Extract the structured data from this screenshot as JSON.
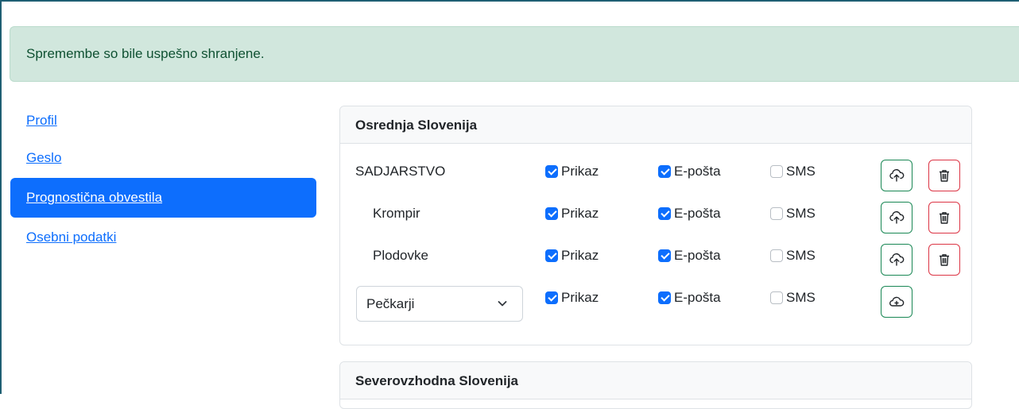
{
  "alert": {
    "message": "Spremembe so bile uspešno shranjene."
  },
  "nav": {
    "items": [
      {
        "label": "Profil"
      },
      {
        "label": "Geslo"
      },
      {
        "label": "Prognostična obvestila"
      },
      {
        "label": "Osebni podatki"
      }
    ]
  },
  "regions": [
    {
      "title": "Osrednja Slovenija",
      "rows": [
        {
          "name": "SADJARSTVO",
          "prikaz": "Prikaz",
          "eposta": "E-pošta",
          "sms": "SMS"
        },
        {
          "name": "Krompir",
          "prikaz": "Prikaz",
          "eposta": "E-pošta",
          "sms": "SMS"
        },
        {
          "name": "Plodovke",
          "prikaz": "Prikaz",
          "eposta": "E-pošta",
          "sms": "SMS"
        }
      ],
      "new_row": {
        "selected": "Pečkarji",
        "prikaz": "Prikaz",
        "eposta": "E-pošta",
        "sms": "SMS"
      }
    },
    {
      "title": "Severovzhodna Slovenija"
    }
  ],
  "colors": {
    "primary": "#0d6efd",
    "success": "#198754",
    "danger": "#dc3545",
    "alert_bg": "#d1e7dd"
  },
  "icons": {
    "save": "cloud-upload-icon",
    "delete": "trash-icon",
    "add": "cloud-plus-icon",
    "dropdown": "chevron-down-icon"
  }
}
